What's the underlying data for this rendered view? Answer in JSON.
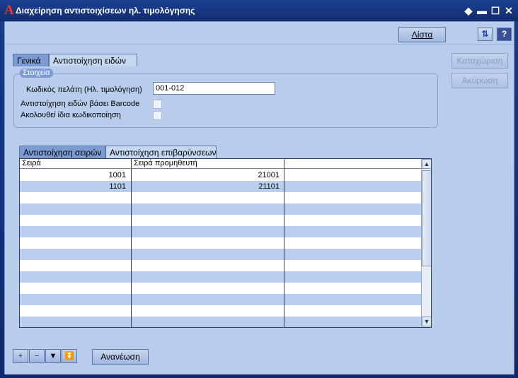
{
  "window": {
    "title": "Διαχείρηση αντιστοιχίσεων ηλ. τιμολόγησης",
    "app_icon": "A",
    "controls": [
      "◆",
      "▬",
      "☐",
      "✕"
    ]
  },
  "toolbar": {
    "list_button": "Λίστα",
    "sort_icon": "sort-arrows-icon",
    "help_icon": "?"
  },
  "side_buttons": {
    "save": "Καταχώριση",
    "cancel": "Ακύρωση"
  },
  "main_tabs": [
    {
      "label": "Γενικά",
      "active": true
    },
    {
      "label": "Αντιστοίχηση ειδών",
      "active": false
    }
  ],
  "group": {
    "legend": "Στοιχεία",
    "customer_code_label": "Κωδικός πελάτη (Ηλ. τιμολόγηση)",
    "customer_code_value": "001-012",
    "barcode_label": "Αντιστοίχηση ειδών βάσει Barcode",
    "same_coding_label": "Ακολουθεί ίδια κωδικοποίηση"
  },
  "sub_tabs": [
    {
      "label": "Αντιστοίχηση σειρών",
      "active": true
    },
    {
      "label": "Αντιστοίχηση επιβαρύνσεων",
      "active": false
    }
  ],
  "grid": {
    "columns": [
      "Σειρά",
      "Σειρά προμηθευτή",
      ""
    ],
    "rows": [
      [
        "1001",
        "21001",
        ""
      ],
      [
        "1101",
        "21101",
        ""
      ]
    ],
    "empty_rows": 13
  },
  "bottom": {
    "nav_icons": [
      "+",
      "−",
      "▼",
      "⏬"
    ],
    "refresh_button": "Ανανέωση"
  }
}
